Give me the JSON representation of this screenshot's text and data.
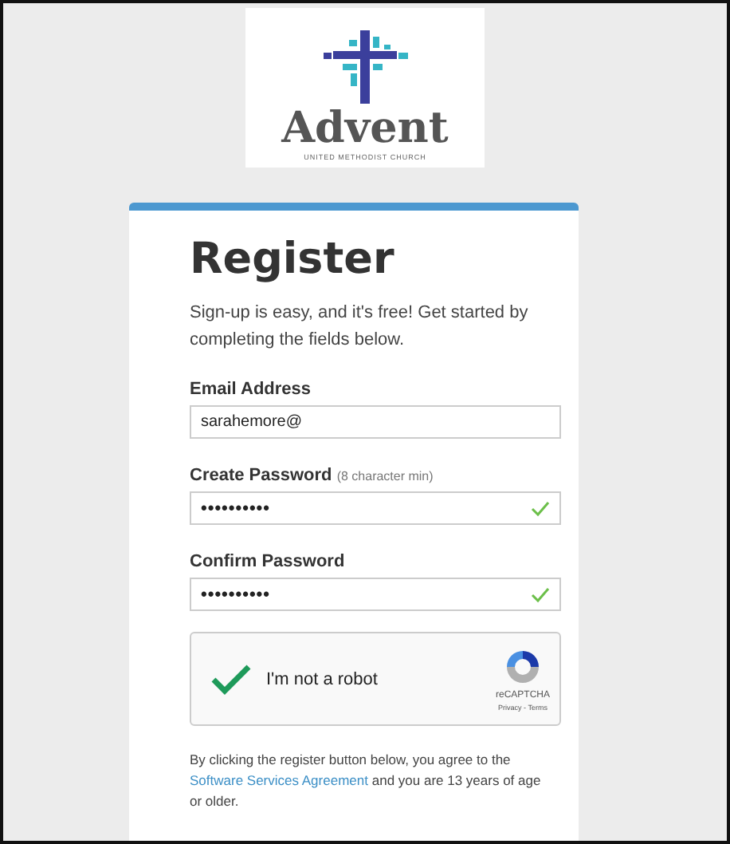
{
  "logo": {
    "name": "Advent",
    "subtitle": "UNITED METHODIST CHURCH"
  },
  "form": {
    "title": "Register",
    "intro": "Sign-up is easy, and it's free! Get started by completing the fields below.",
    "fields": [
      {
        "label": "Email Address",
        "value": "sarahemore@",
        "kind": "text",
        "valid": false
      },
      {
        "label": "Create Password",
        "hint": "(8 character min)",
        "value": "••••••••••",
        "kind": "password",
        "valid": true
      },
      {
        "label": "Confirm Password",
        "value": "••••••••••",
        "kind": "password",
        "valid": true
      }
    ],
    "captcha": {
      "label": "I'm not a robot",
      "checked": true,
      "brand": "reCAPTCHA",
      "links": "Privacy - Terms"
    },
    "agreement": {
      "before": "By clicking the register button below, you agree to the",
      "link": "Software Services Agreement",
      "after": "and you are 13 years of age or older."
    }
  }
}
